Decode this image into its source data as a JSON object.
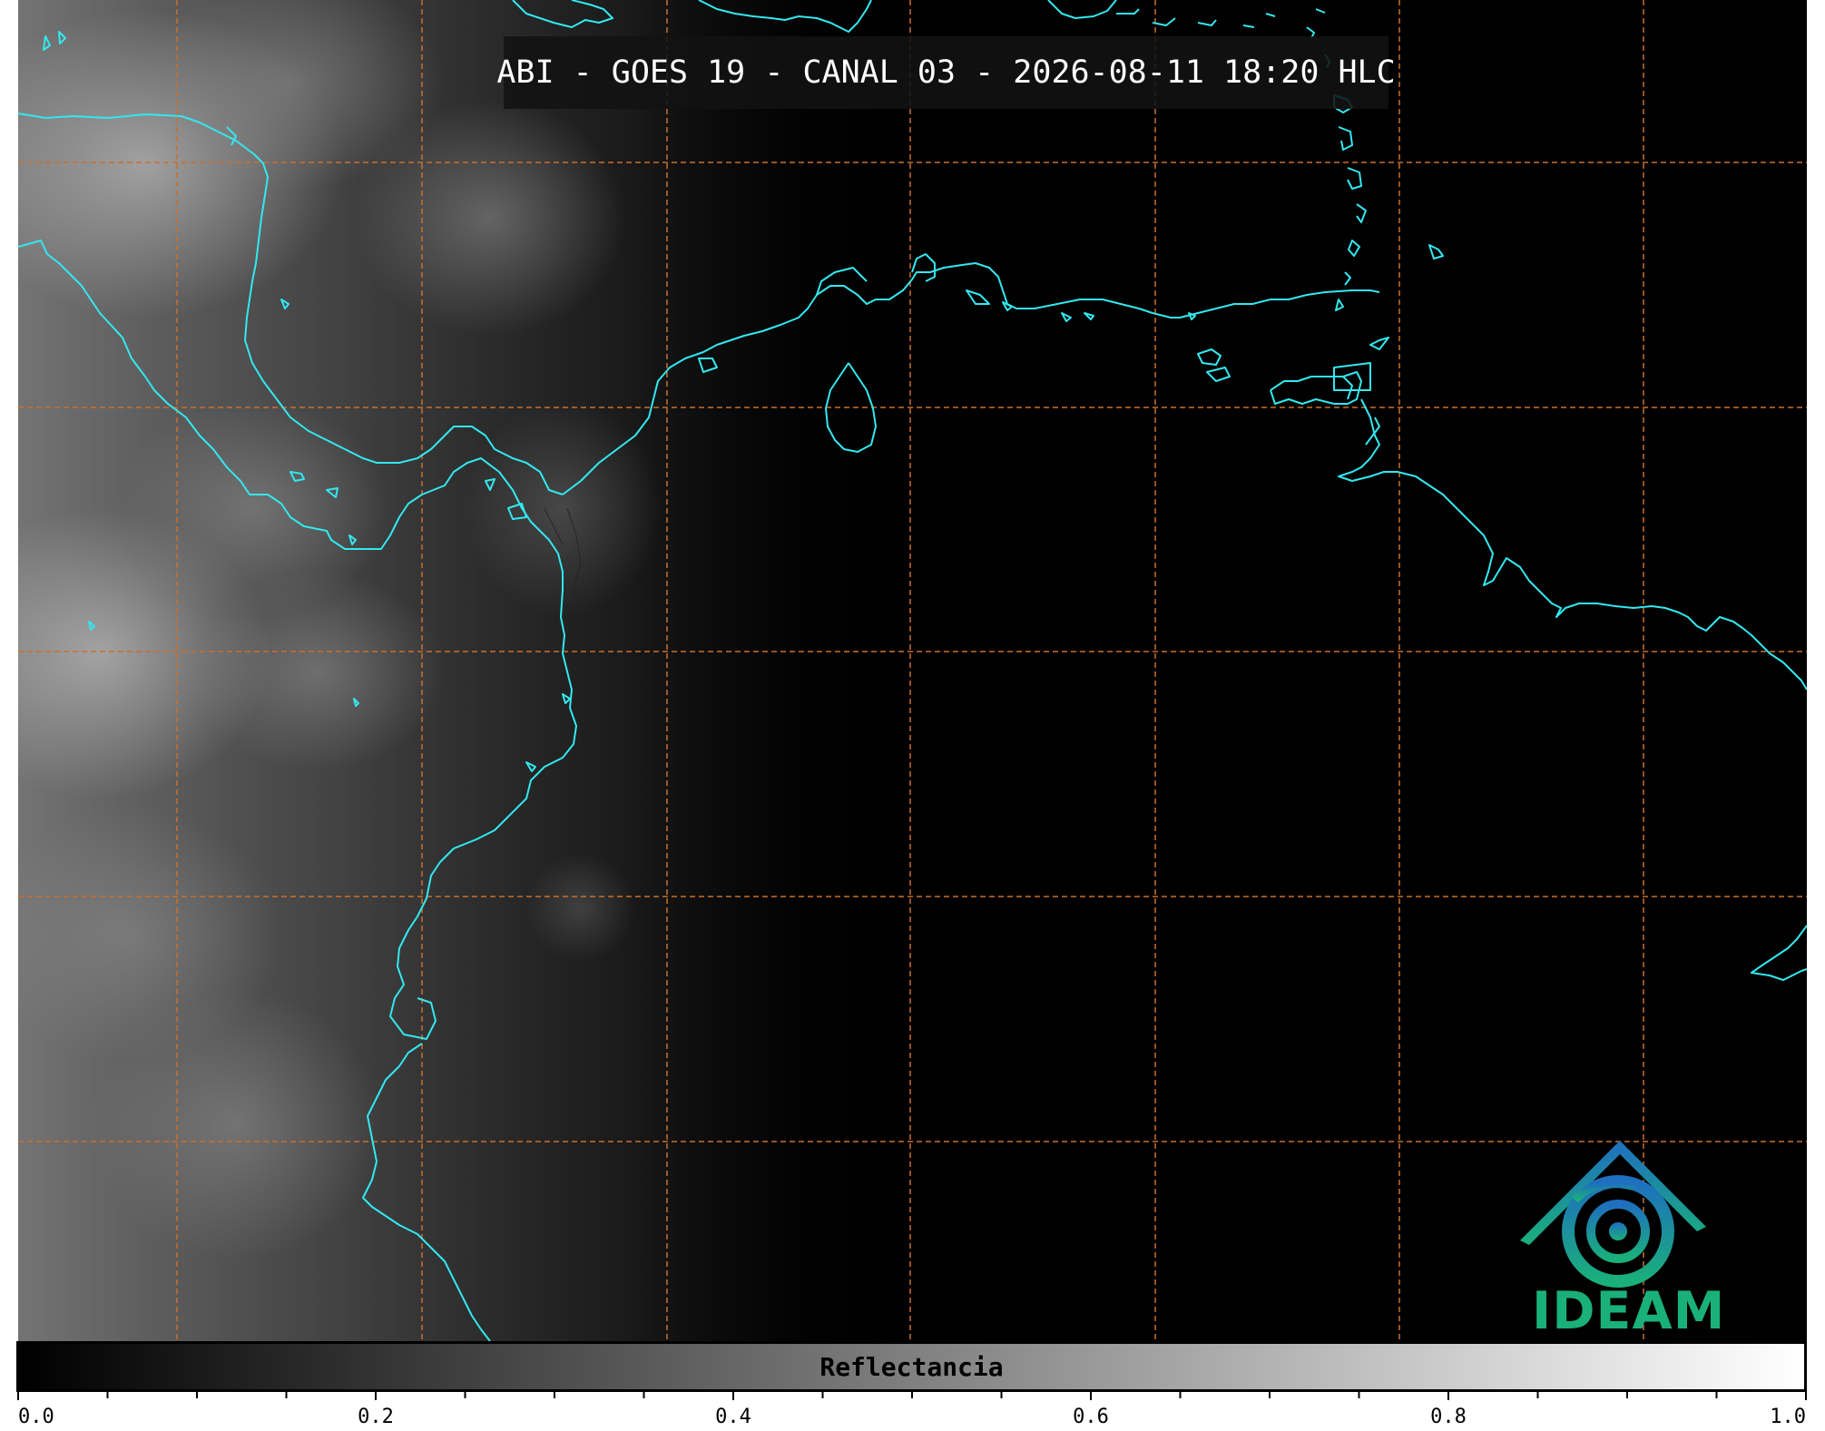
{
  "title": "ABI - GOES 19 - CANAL 03 - 2026-08-11 18:20 HLC",
  "logo": {
    "text": "IDEAM",
    "color": "#1ab07a",
    "accent": "#1e88b8"
  },
  "colorbar": {
    "label": "Reflectancia",
    "range": [
      0.0,
      1.0
    ],
    "ticks": [
      "0.0",
      "0.2",
      "0.4",
      "0.6",
      "0.8",
      "1.0"
    ],
    "colormap": "grayscale"
  },
  "map": {
    "coastline_color": "#33e8f0",
    "grid_color": "#c8702e",
    "grid_style": "dashed",
    "background": "#000000"
  }
}
